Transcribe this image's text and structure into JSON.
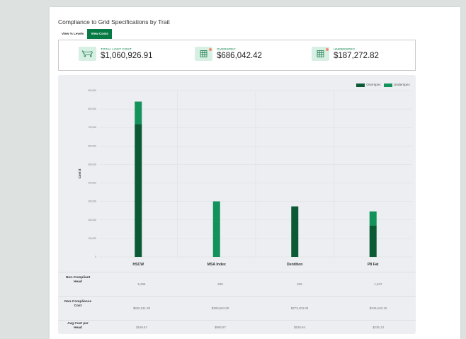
{
  "page": {
    "title": "Compliance to Grid Specifications by Trait",
    "tabs": [
      {
        "label": "View % Levels",
        "active": false
      },
      {
        "label": "View Costs",
        "active": true
      }
    ]
  },
  "kpis": [
    {
      "label": "TOTAL LOST COST",
      "value": "$1,060,926.91",
      "icon": "cow-icon"
    },
    {
      "label": "OVERSPEC",
      "value": "$686,042.42",
      "icon": "grid-icon"
    },
    {
      "label": "UNDERSPEC",
      "value": "$187,272.82",
      "icon": "grid-icon"
    }
  ],
  "colors": {
    "overspec": "#0b5a35",
    "underspec": "#14925c",
    "accent": "#067a45"
  },
  "chart_data": {
    "type": "bar",
    "stacked": true,
    "categories": [
      "HSCW",
      "MSA Index",
      "Dentition",
      "P8 Fat"
    ],
    "series": [
      {
        "name": "Overspec",
        "values": [
          718000,
          0,
          273404,
          170000
        ]
      },
      {
        "name": "Underspec",
        "values": [
          122511,
          300604,
          0,
          76162
        ]
      }
    ],
    "ylabel": "Cost $",
    "ylim": [
      0,
      900000
    ],
    "yticks": [
      "0",
      "100,000",
      "200,000",
      "300,000",
      "400,000",
      "500,000",
      "600,000",
      "700,000",
      "800,000",
      "900,000"
    ],
    "legend_position": "top-right",
    "grid": true
  },
  "table": {
    "rows": [
      {
        "label": "Non-Compliant Head",
        "values": [
          "5,256",
          "509",
          "525",
          "1,047"
        ]
      },
      {
        "label": "Non-Compliance Cost",
        "values": [
          "$840,511.30",
          "$300,604.00",
          "$273,404.00",
          "$246,162.10"
        ]
      },
      {
        "label": "Avg Cost per Head",
        "values": [
          "$159.67",
          "$590.97",
          "$520.94",
          "$235.13"
        ]
      }
    ]
  }
}
